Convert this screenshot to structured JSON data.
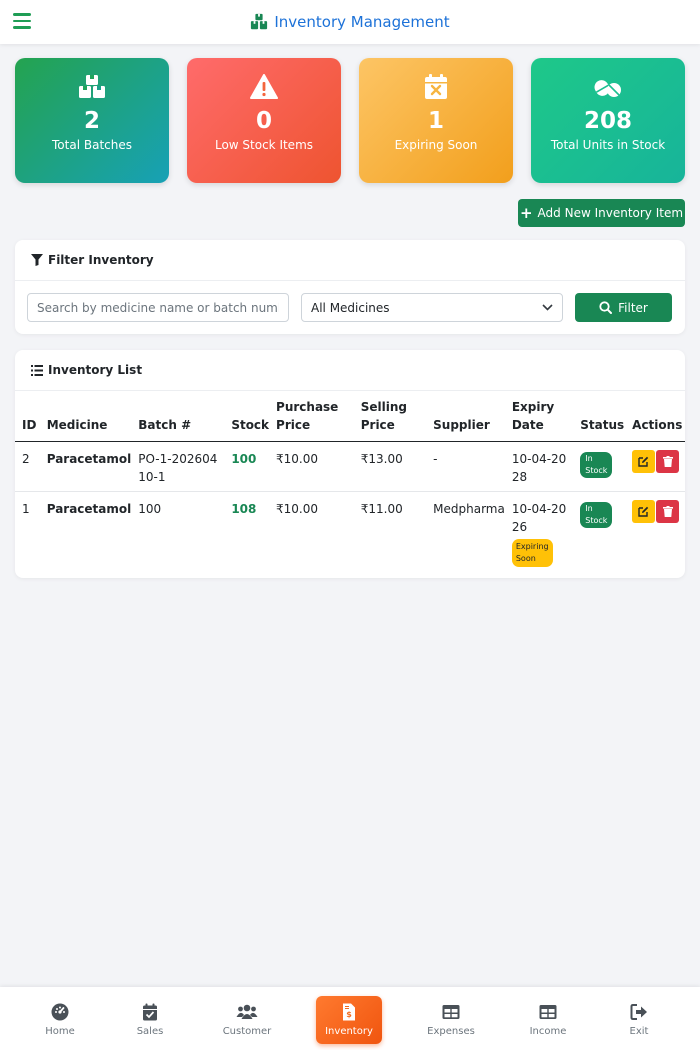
{
  "header": {
    "title": "Inventory Management"
  },
  "cards": [
    {
      "value": "2",
      "label": "Total Batches"
    },
    {
      "value": "0",
      "label": "Low Stock Items"
    },
    {
      "value": "1",
      "label": "Expiring Soon"
    },
    {
      "value": "208",
      "label": "Total Units in Stock"
    }
  ],
  "add_button": "Add New Inventory Item",
  "filter": {
    "title": "Filter Inventory",
    "search_placeholder": "Search by medicine name or batch number...",
    "select_value": "All Medicines",
    "button": "Filter"
  },
  "list": {
    "title": "Inventory List",
    "columns": [
      "ID",
      "Medicine",
      "Batch #",
      "Stock",
      "Purchase Price",
      "Selling Price",
      "Supplier",
      "Expiry Date",
      "Status",
      "Actions"
    ],
    "rows": [
      {
        "id": "2",
        "medicine": "Paracetamol",
        "batch": "PO-1-20260410-1",
        "stock": "100",
        "purchase": "₹10.00",
        "selling": "₹13.00",
        "supplier": "-",
        "expiry": "10-04-2028",
        "status_in": "In",
        "status_stock": "Stock",
        "warning": ""
      },
      {
        "id": "1",
        "medicine": "Paracetamol",
        "batch": "100",
        "stock": "108",
        "purchase": "₹10.00",
        "selling": "₹11.00",
        "supplier": "Medpharma",
        "expiry": "10-04-2026",
        "status_in": "In",
        "status_stock": "Stock",
        "warning_a": "Expiring",
        "warning_b": "Soon"
      }
    ]
  },
  "nav": [
    {
      "label": "Home",
      "icon": "dashboard-icon"
    },
    {
      "label": "Sales",
      "icon": "calendar-check-icon"
    },
    {
      "label": "Customer",
      "icon": "users-icon"
    },
    {
      "label": "Inventory",
      "icon": "file-invoice-dollar-icon",
      "active": true
    },
    {
      "label": "Expenses",
      "icon": "table-icon"
    },
    {
      "label": "Income",
      "icon": "table-icon"
    },
    {
      "label": "Exit",
      "icon": "sign-out-icon"
    }
  ],
  "colors": {
    "primary": "#198754",
    "brand": "#1d72d8",
    "active_nav": "#f26b1d",
    "danger": "#dc3545",
    "warning": "#ffc107"
  }
}
